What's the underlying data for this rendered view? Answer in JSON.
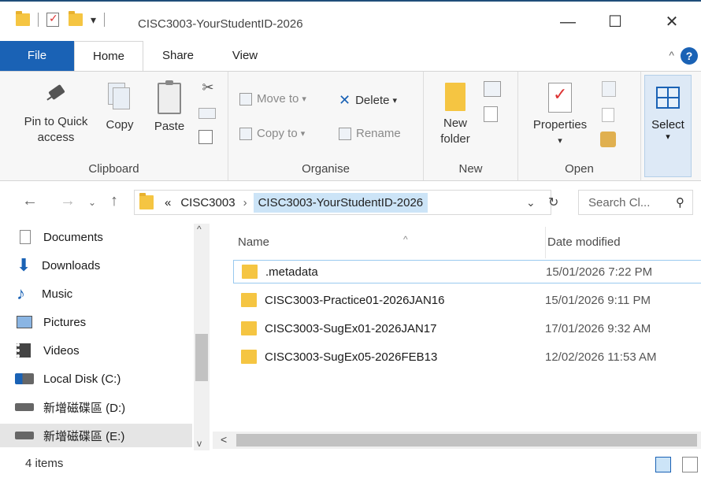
{
  "window": {
    "title": "CISC3003-YourStudentID-2026",
    "minimize": "—",
    "maximize": "☐",
    "close": "✕",
    "qat_dropdown": "▾"
  },
  "tabs": {
    "file": "File",
    "home": "Home",
    "share": "Share",
    "view": "View",
    "help": "?",
    "collapse": "^"
  },
  "ribbon": {
    "clipboard": {
      "label": "Clipboard",
      "pin_line1": "Pin to Quick",
      "pin_line2": "access",
      "copy": "Copy",
      "paste": "Paste"
    },
    "organise": {
      "label": "Organise",
      "move_to": "Move to",
      "copy_to": "Copy to",
      "delete": "Delete",
      "rename": "Rename"
    },
    "new": {
      "label": "New",
      "new_folder_line1": "New",
      "new_folder_line2": "folder"
    },
    "open": {
      "label": "Open",
      "properties": "Properties"
    },
    "select": {
      "label": "Select"
    }
  },
  "address": {
    "overflow": "«",
    "crumbs": [
      "CISC3003",
      "CISC3003-YourStudentID-2026"
    ],
    "search_placeholder": "Search Cl..."
  },
  "nav_pane": {
    "items": [
      "Documents",
      "Downloads",
      "Music",
      "Pictures",
      "Videos",
      "Local Disk (C:)",
      "新增磁碟區 (D:)",
      "新增磁碟區 (E:)"
    ]
  },
  "file_list": {
    "columns": {
      "name": "Name",
      "date": "Date modified"
    },
    "rows": [
      {
        "name": ".metadata",
        "date": "15/01/2026 7:22 PM"
      },
      {
        "name": "CISC3003-Practice01-2026JAN16",
        "date": "15/01/2026 9:11 PM"
      },
      {
        "name": "CISC3003-SugEx01-2026JAN17",
        "date": "17/01/2026 9:32 AM"
      },
      {
        "name": "CISC3003-SugEx05-2026FEB13",
        "date": "12/02/2026 11:53 AM"
      }
    ]
  },
  "status": {
    "items_count": "4 items"
  }
}
